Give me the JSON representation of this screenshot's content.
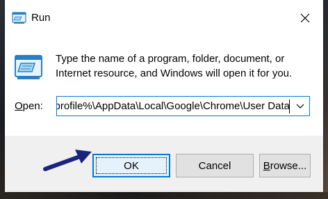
{
  "window": {
    "title": "Run",
    "close_glyph": "✕"
  },
  "description": {
    "line1": "Type the name of a program, folder, document, or",
    "line2": "Internet resource, and Windows will open it for you."
  },
  "open_field": {
    "label_underlined": "O",
    "label_rest": "pen:",
    "value": "%userprofile%\\AppData\\Local\\Google\\Chrome\\User Data"
  },
  "buttons": {
    "ok": "OK",
    "cancel": "Cancel",
    "browse_underlined": "B",
    "browse_rest": "rowse..."
  },
  "icons": {
    "title_icon": "run-app-icon",
    "close": "close-icon",
    "dropdown": "chevron-down-icon",
    "annotation": "arrow-icon"
  },
  "colors": {
    "accent": "#0078d7",
    "annotation_arrow": "#1a237e"
  }
}
